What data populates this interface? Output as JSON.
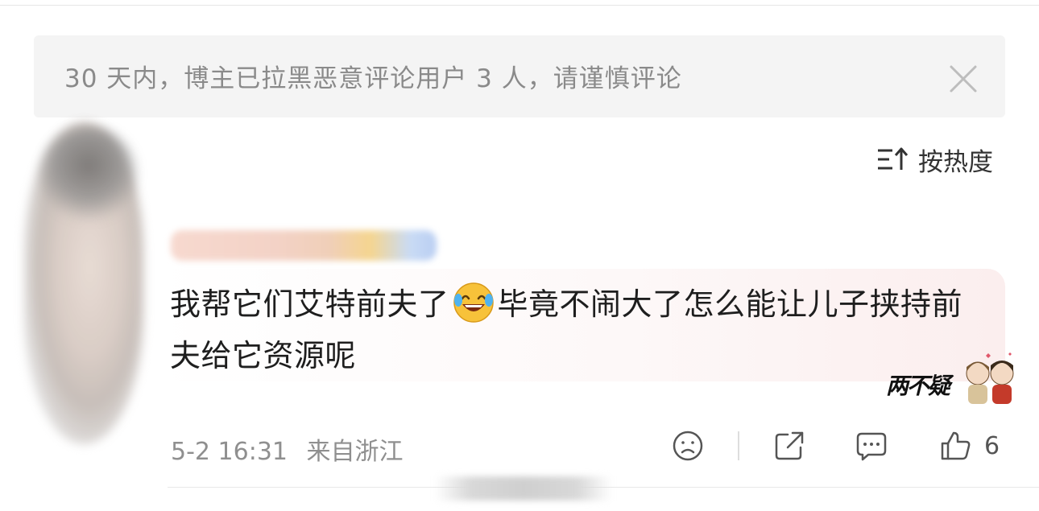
{
  "notice": {
    "text": "30 天内，博主已拉黑恶意评论用户 3 人，请谨慎评论",
    "close_icon": "close-icon"
  },
  "sort": {
    "label": "按热度",
    "icon": "sort-icon"
  },
  "comment": {
    "text_before_emoji": "我帮它们艾特前夫了",
    "emoji": "laughing-tears-emoji",
    "text_after_emoji": "毕竟不闹大了怎么能让儿子挟持前夫给它资源呢",
    "time": "5-2 16:31",
    "location": "来自浙江",
    "like_count": "6"
  },
  "watermark": {
    "text": "两不疑"
  },
  "actions": [
    {
      "name": "dislike-face-icon"
    },
    {
      "name": "share-icon"
    },
    {
      "name": "comment-icon"
    },
    {
      "name": "thumbs-up-icon"
    }
  ],
  "colors": {
    "notice_bg": "#f4f4f4",
    "notice_text": "#8a8a8a",
    "meta_text": "#8f8f8f",
    "body_text": "#1e1e1e",
    "emoji_yellow": "#f7c23a"
  }
}
